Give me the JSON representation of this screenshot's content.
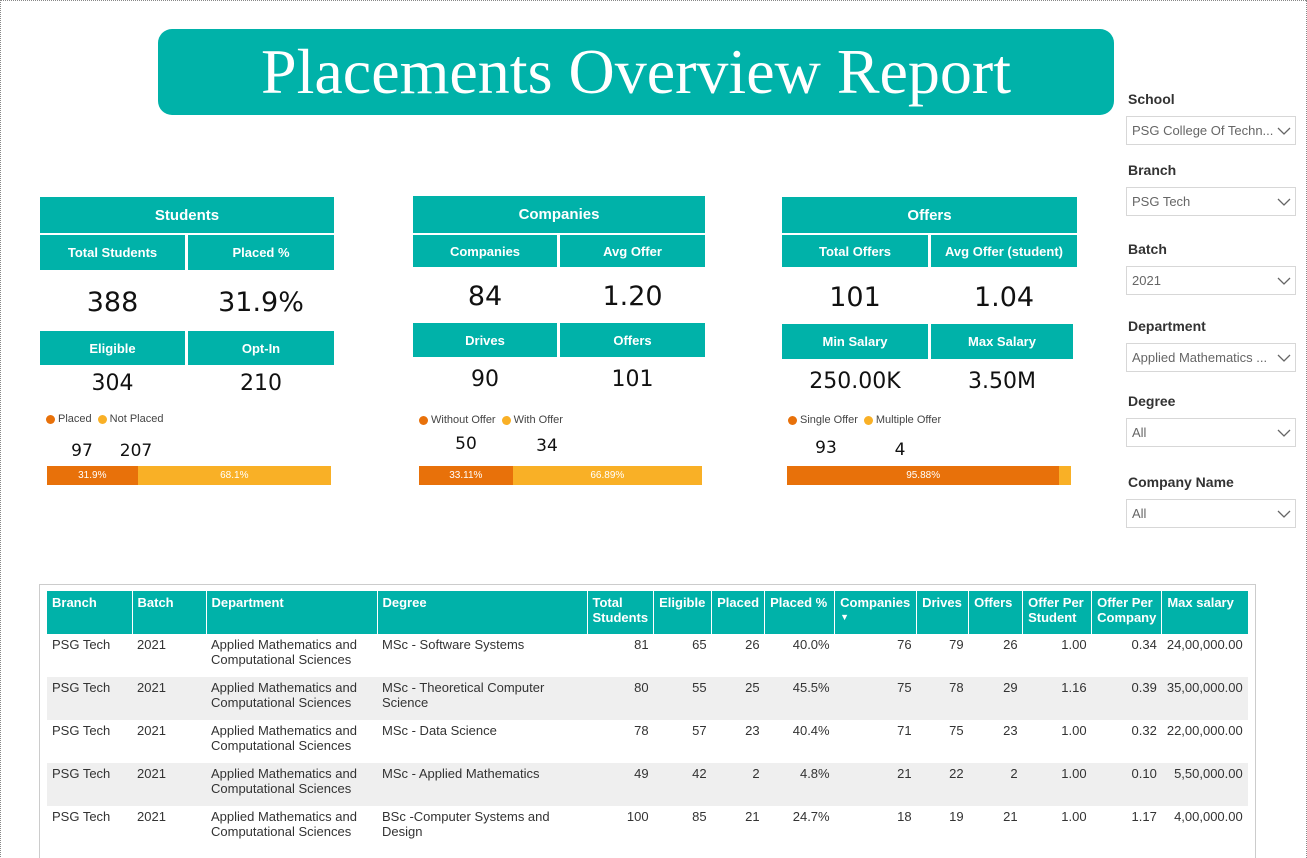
{
  "title": "Placements Overview Report",
  "colors": {
    "accent": "#00B2A9",
    "orange": "#E8710A",
    "yellow": "#F9B026"
  },
  "students": {
    "header": "Students",
    "total_label": "Total Students",
    "placed_pct_label": "Placed %",
    "total": "388",
    "placed_pct": "31.9%",
    "eligible_label": "Eligible",
    "optin_label": "Opt-In",
    "eligible": "304",
    "optin": "210",
    "legend_a": "Placed",
    "legend_b": "Not Placed",
    "a_value": "97",
    "b_value": "207",
    "bar_a": "31.9%",
    "bar_b": "68.1%",
    "bar_a_frac": 0.319
  },
  "companies": {
    "header": "Companies",
    "companies_label": "Companies",
    "avg_offer_label": "Avg Offer",
    "companies": "84",
    "avg_offer": "1.20",
    "drives_label": "Drives",
    "offers_label": "Offers",
    "drives": "90",
    "offers": "101",
    "legend_a": "Without Offer",
    "legend_b": "With Offer",
    "a_value": "50",
    "b_value": "34",
    "bar_a": "33.11%",
    "bar_b": "66.89%",
    "bar_a_frac": 0.3311
  },
  "offers": {
    "header": "Offers",
    "total_label": "Total Offers",
    "avg_label": "Avg Offer (student)",
    "total": "101",
    "avg": "1.04",
    "min_label": "Min Salary",
    "max_label": "Max Salary",
    "min": "250.00K",
    "max": "3.50M",
    "legend_a": "Single Offer",
    "legend_b": "Multiple Offer",
    "a_value": "93",
    "b_value": "4",
    "bar_a": "95.88%",
    "bar_a_frac": 0.9588
  },
  "slicers": [
    {
      "label": "School",
      "value": "PSG College Of Techn..."
    },
    {
      "label": "Branch",
      "value": "PSG Tech"
    },
    {
      "label": "Batch",
      "value": "2021"
    },
    {
      "label": "Department",
      "value": "Applied Mathematics ..."
    },
    {
      "label": "Degree",
      "value": "All"
    },
    {
      "label": "Company Name",
      "value": "All"
    }
  ],
  "table": {
    "headers": [
      "Branch",
      "Batch",
      "Department",
      "Degree",
      "Total Students",
      "Eligible",
      "Placed",
      "Placed %",
      "Companies",
      "Drives",
      "Offers",
      "Offer Per Student",
      "Offer Per Company",
      "Max salary"
    ],
    "rows": [
      [
        "PSG Tech",
        "2021",
        "Applied Mathematics and Computational Sciences",
        "MSc - Software Systems",
        "81",
        "65",
        "26",
        "40.0%",
        "76",
        "79",
        "26",
        "1.00",
        "0.34",
        "24,00,000.00"
      ],
      [
        "PSG Tech",
        "2021",
        "Applied Mathematics and Computational Sciences",
        "MSc - Theoretical Computer Science",
        "80",
        "55",
        "25",
        "45.5%",
        "75",
        "78",
        "29",
        "1.16",
        "0.39",
        "35,00,000.00"
      ],
      [
        "PSG Tech",
        "2021",
        "Applied Mathematics and Computational Sciences",
        "MSc - Data Science",
        "78",
        "57",
        "23",
        "40.4%",
        "71",
        "75",
        "23",
        "1.00",
        "0.32",
        "22,00,000.00"
      ],
      [
        "PSG Tech",
        "2021",
        "Applied Mathematics and Computational Sciences",
        "MSc - Applied Mathematics",
        "49",
        "42",
        "2",
        "4.8%",
        "21",
        "22",
        "2",
        "1.00",
        "0.10",
        "5,50,000.00"
      ],
      [
        "PSG Tech",
        "2021",
        "Applied Mathematics and Computational Sciences",
        "BSc -Computer Systems and Design",
        "100",
        "85",
        "21",
        "24.7%",
        "18",
        "19",
        "21",
        "1.00",
        "1.17",
        "4,00,000.00"
      ]
    ]
  }
}
